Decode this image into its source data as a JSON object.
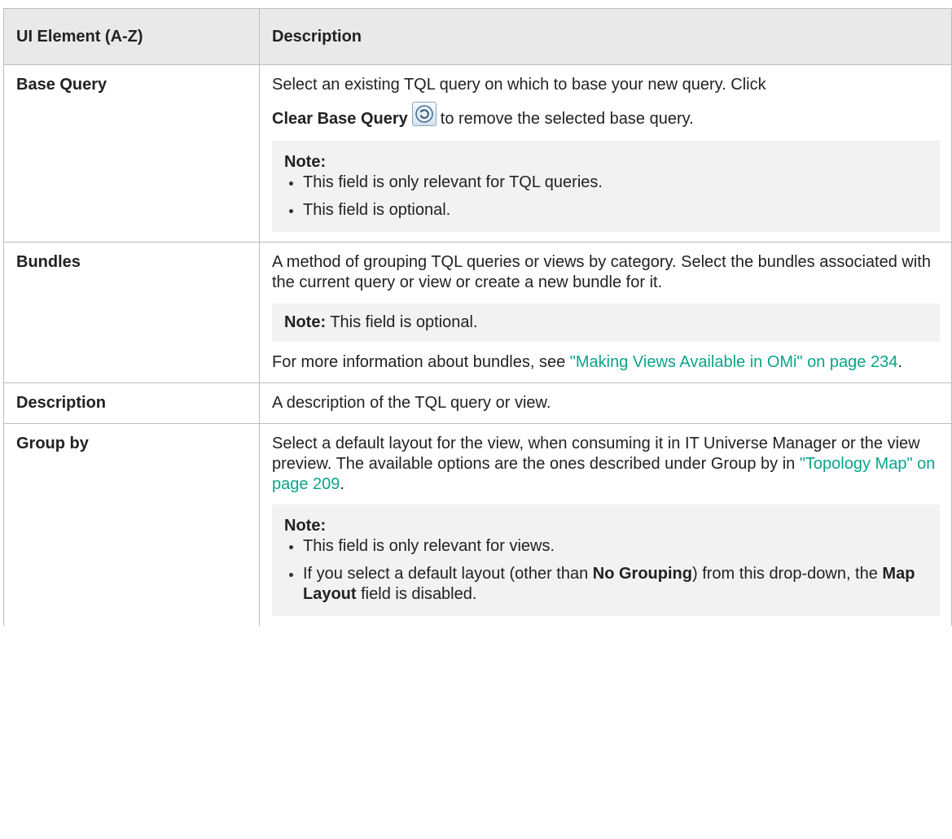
{
  "headers": [
    "UI Element (A-Z)",
    "Description"
  ],
  "rows": {
    "base_query": {
      "name": "Base Query",
      "text1": "Select an existing TQL query on which to base your new query. Click",
      "btn": "Clear Base Query",
      "text2": "to remove the selected base query.",
      "note_title": "Note:",
      "bullets": [
        "This field is only relevant for TQL queries.",
        "This field is optional."
      ]
    },
    "bundles": {
      "name": "Bundles",
      "text1": "A method of grouping TQL queries or views by category. Select the bundles associated with the current query or view or create a new bundle for it.",
      "note_title": "Note:",
      "note_text": "This field is optional.",
      "more_text": "For more information about bundles, see",
      "link": "\"Making Views Available in OMi\" on page 234",
      "end": "."
    },
    "description": {
      "name": "Description",
      "text1": "A description of the TQL query or view."
    },
    "group_by": {
      "name": "Group by",
      "text1": "Select a default layout for the view, when consuming it in IT Universe Manager or the view preview. The available options are the ones described under Group by in",
      "link": "\"Topology Map\" on page 209",
      "end": ".",
      "note_title": "Note:",
      "bullet1": "This field is only relevant for views.",
      "bullet2_a": "If you select a default layout (other than",
      "bullet2_b": "No Grouping",
      "bullet2_c": ") from this drop-down, the",
      "bullet2_d": "Map Layout",
      "bullet2_e": "field is disabled."
    }
  },
  "icons": {
    "clear_base_query": "refresh-circle-icon"
  },
  "colors": {
    "header_bg": "#e9e9e9",
    "note_bg": "#f2f2f2",
    "link": "#0aa48a",
    "border": "#bdbdbd"
  }
}
